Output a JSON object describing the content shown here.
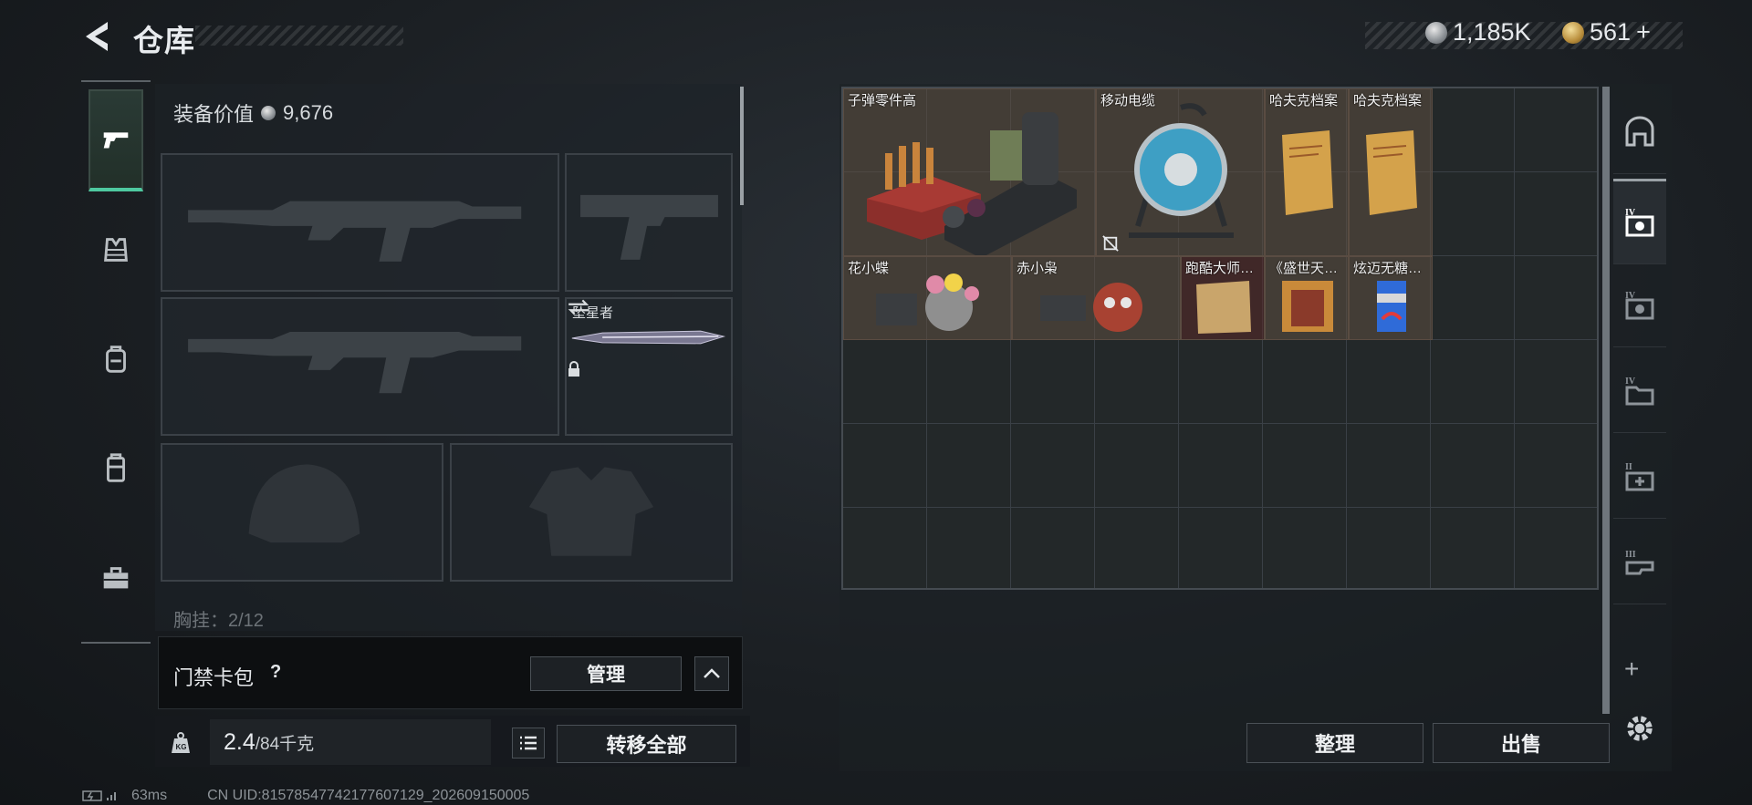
{
  "header": {
    "title": "仓库",
    "currency_silver": "1,185K",
    "currency_gold": "561",
    "currency_gold_plus": "+"
  },
  "left_tabs": [
    {
      "name": "weapons",
      "icon": "pistol-icon"
    },
    {
      "name": "armor",
      "icon": "vest-icon"
    },
    {
      "name": "backpack",
      "icon": "backpack-icon"
    },
    {
      "name": "container",
      "icon": "locker-icon"
    },
    {
      "name": "toolbox",
      "icon": "toolbox-icon"
    }
  ],
  "equipment": {
    "value_label": "装备价值",
    "value": "9,676",
    "melee_slot_label": "坠星者",
    "chest_label": "胸挂：2/12"
  },
  "access_card": {
    "label": "门禁卡包",
    "help": "?",
    "manage": "管理"
  },
  "weight": {
    "current": "2.4",
    "max": "/84千克"
  },
  "transfer_all": "转移全部",
  "storage_items": [
    {
      "name": "子弹零件高",
      "color": "#5f4e42"
    },
    {
      "name": "移动电缆",
      "color": "#5f4e42"
    },
    {
      "name": "哈夫克档案",
      "color": "#5f4e42"
    },
    {
      "name": "哈夫克档案",
      "color": "#5f4e42"
    },
    {
      "name": "花小蝶",
      "color": "#5f4e42"
    },
    {
      "name": "赤小枭",
      "color": "#5f4e42"
    },
    {
      "name": "跑酷大师…",
      "color": "#5a2828"
    },
    {
      "name": "《盛世天…",
      "color": "#5f4e42"
    },
    {
      "name": "炫迈无糖…",
      "color": "#5f4e42"
    }
  ],
  "actions": {
    "sort": "整理",
    "sell": "出售"
  },
  "status": {
    "ping": "63ms",
    "uid": "CN UID:815785477421776071​29_202609150005"
  }
}
